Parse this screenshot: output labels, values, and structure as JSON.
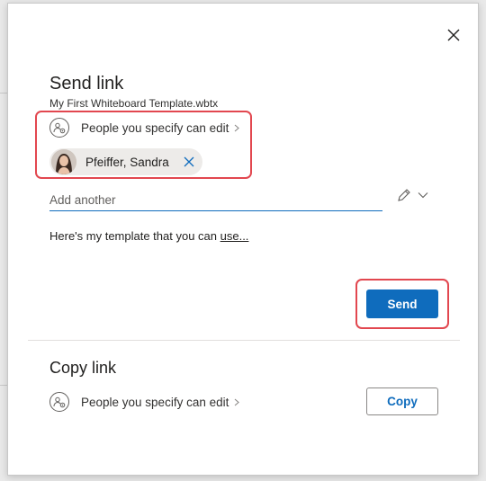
{
  "dialog": {
    "title": "Send link",
    "filename": "My First Whiteboard Template.wbtx",
    "close_icon": "close-icon"
  },
  "send_link": {
    "permission_label": "People you specify can edit",
    "permission_icon": "people-settings-icon",
    "recipients": [
      {
        "name": "Pfeiffer, Sandra",
        "avatar": "avatar-photo"
      }
    ],
    "add_another_placeholder": "Add another",
    "message_text": "Here's my template that you can ",
    "message_link": "use...",
    "send_label": "Send"
  },
  "copy_link": {
    "title": "Copy link",
    "permission_label": "People you specify can edit",
    "copy_label": "Copy"
  },
  "colors": {
    "accent": "#0f6cbd",
    "highlight": "#e2474f"
  }
}
